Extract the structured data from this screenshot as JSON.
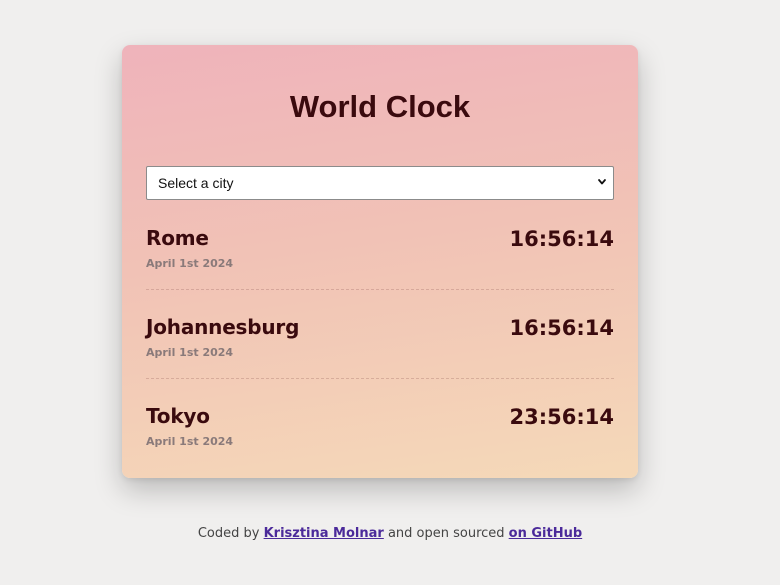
{
  "app": {
    "title": "World Clock"
  },
  "city_select": {
    "placeholder": "Select a city",
    "chevron_icon": "chevron-down-icon"
  },
  "cities": [
    {
      "name": "Rome",
      "date": "April 1st 2024",
      "time": "16:56:14"
    },
    {
      "name": "Johannesburg",
      "date": "April 1st 2024",
      "time": "16:56:14"
    },
    {
      "name": "Tokyo",
      "date": "April 1st 2024",
      "time": "23:56:14"
    }
  ],
  "footer": {
    "prefix": "Coded by ",
    "author_link": "Krisztina Molnar",
    "middle": " and open sourced ",
    "github_link": "on GitHub"
  },
  "colors": {
    "background": "#f0efee",
    "card_gradient_top": "#efb3bb",
    "card_gradient_bottom": "#f5d9b8",
    "text_dark": "#3a0a0e",
    "link": "#4b2a9a"
  }
}
